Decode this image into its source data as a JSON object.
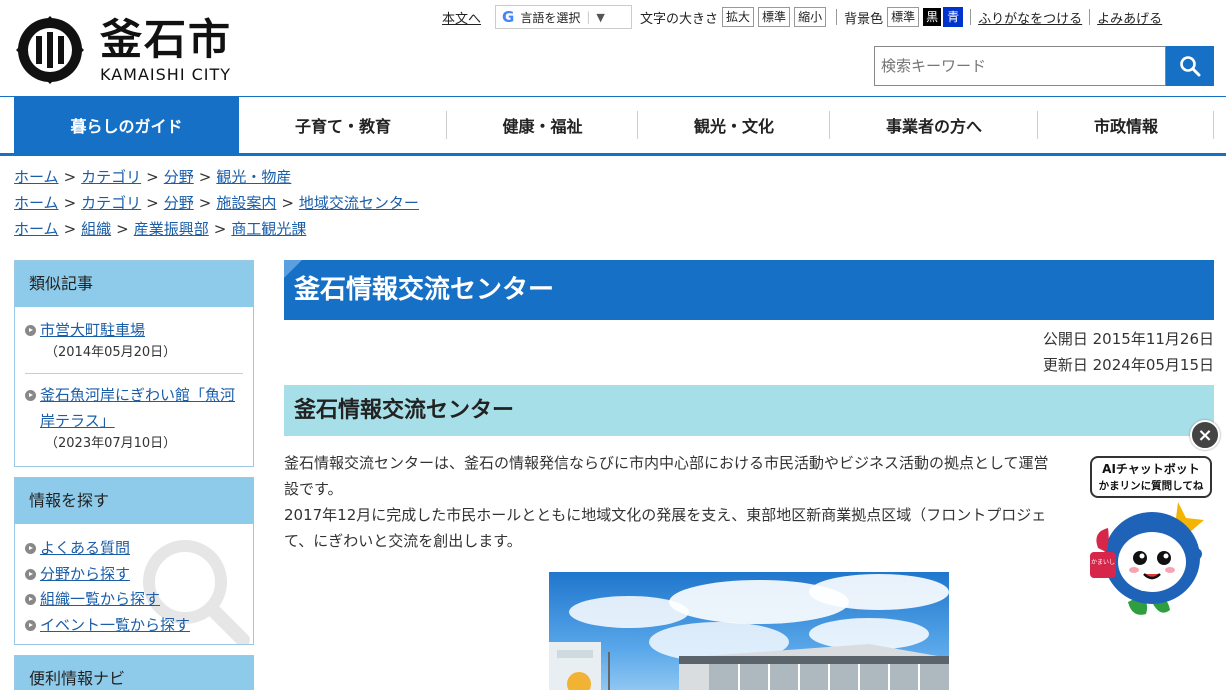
{
  "header": {
    "logo_jp": "釜石市",
    "logo_en": "KAMAISHI CITY",
    "skip_link": "本文へ",
    "translate_label": "言語を選択",
    "font_size_label": "文字の大きさ",
    "font_size_buttons": [
      "拡大",
      "標準",
      "縮小"
    ],
    "bg_color_label": "背景色",
    "bg_color_buttons": [
      "標準",
      "黒",
      "青"
    ],
    "furigana_link": "ふりがなをつける",
    "read_aloud_link": "よみあげる",
    "search_placeholder": "検索キーワード"
  },
  "gnav": [
    {
      "label": "暮らしのガイド",
      "active": true
    },
    {
      "label": "子育て・教育"
    },
    {
      "label": "健康・福祉"
    },
    {
      "label": "観光・文化"
    },
    {
      "label": "事業者の方へ"
    },
    {
      "label": "市政情報"
    }
  ],
  "breadcrumbs": [
    [
      "ホーム",
      "カテゴリ",
      "分野",
      "観光・物産"
    ],
    [
      "ホーム",
      "カテゴリ",
      "分野",
      "施設案内",
      "地域交流センター"
    ],
    [
      "ホーム",
      "組織",
      "産業振興部",
      "商工観光課"
    ]
  ],
  "sidebar": {
    "similar_title": "類似記事",
    "similar_items": [
      {
        "title": "市営大町駐車場",
        "date": "（2014年05月20日）"
      },
      {
        "title": "釜石魚河岸にぎわい館「魚河岸テラス」",
        "date": "（2023年07月10日）"
      }
    ],
    "find_title": "情報を探す",
    "find_items": [
      "よくある質問",
      "分野から探す",
      "組織一覧から探す",
      "イベント一覧から探す"
    ],
    "navi_title": "便利情報ナビ"
  },
  "main": {
    "title": "釜石情報交流センター",
    "published": "公開日 2015年11月26日",
    "updated": "更新日 2024年05月15日",
    "heading": "釜石情報交流センター",
    "para1_line1": "釜石情報交流センターは、釜石の情報発信ならびに市内中心部における市民活動やビジネス活動の拠点として運営",
    "para1_line2": "設です。",
    "para2_line1": "2017年12月に完成した市民ホールとともに地域文化の発展を支え、東部地区新商業拠点区域（フロントプロジェ",
    "para2_line2": "て、にぎわいと交流を創出します。"
  },
  "chatbot": {
    "close": "×",
    "line1": "AIチャットボット",
    "line2": "かまリンに質問してね",
    "badge": "かまいし"
  },
  "colors": {
    "primary": "#1670c6",
    "light_blue": "#8ecbeb",
    "heading_bg": "#a6dfe8",
    "link": "#1a5ea8"
  }
}
